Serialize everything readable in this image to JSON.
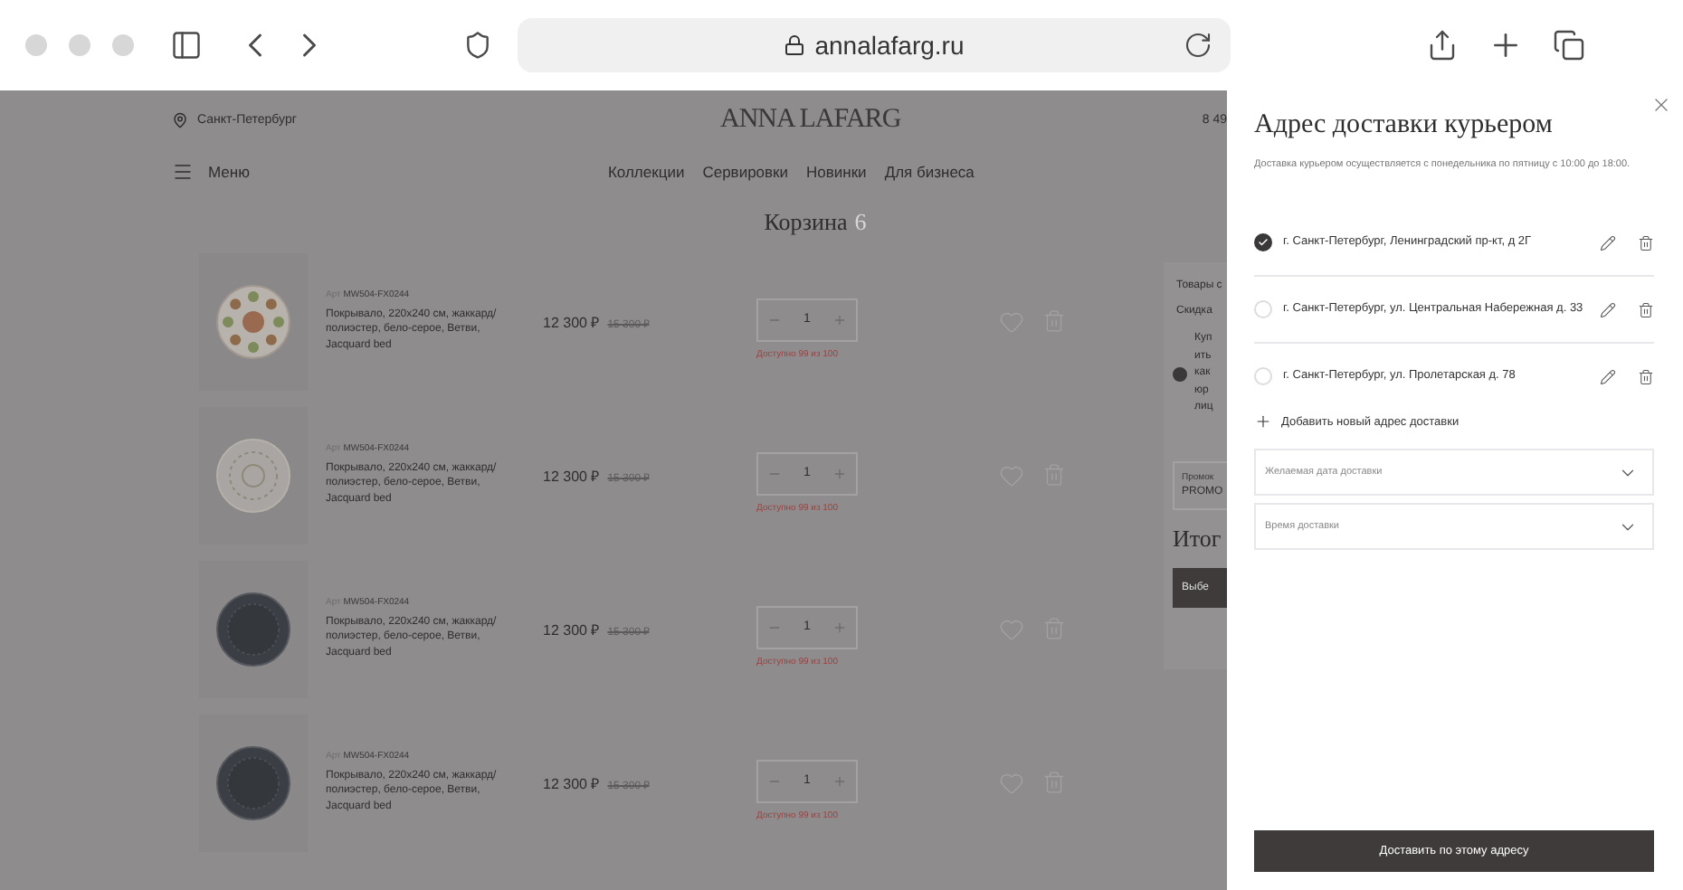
{
  "browser": {
    "url": "annalafarg.ru"
  },
  "header": {
    "city": "Санкт-Петербург",
    "logo": "ANNA LAFARG",
    "phone": "8 49"
  },
  "menu": {
    "label": "Меню"
  },
  "nav": [
    "Коллекции",
    "Сервировки",
    "Новинки",
    "Для бизнеса"
  ],
  "cart": {
    "title": "Корзина",
    "count": "6"
  },
  "items": [
    {
      "kind": "floral",
      "art_label": "Арт",
      "art": "MW504-FX0244",
      "name": "Покрывало, 220x240 см, жаккард/ полиэстер, бело-серое, Ветви, Jacquard bed",
      "price": "12 300 ₽",
      "old_price": "15 300 ₽",
      "qty": "1",
      "stock": "Доступно 99 из 100"
    },
    {
      "kind": "pale",
      "art_label": "Арт",
      "art": "MW504-FX0244",
      "name": "Покрывало, 220x240 см, жаккард/ полиэстер, бело-серое, Ветви, Jacquard bed",
      "price": "12 300 ₽",
      "old_price": "15 300 ₽",
      "qty": "1",
      "stock": "Доступно 99 из 100"
    },
    {
      "kind": "dark",
      "art_label": "Арт",
      "art": "MW504-FX0244",
      "name": "Покрывало, 220x240 см, жаккард/ полиэстер, бело-серое, Ветви, Jacquard bed",
      "price": "12 300 ₽",
      "old_price": "15 300 ₽",
      "qty": "1",
      "stock": "Доступно 99 из 100"
    },
    {
      "kind": "dark",
      "art_label": "Арт",
      "art": "MW504-FX0244",
      "name": "Покрывало, 220x240 см, жаккард/ полиэстер, бело-серое, Ветви, Jacquard bed",
      "price": "12 300 ₽",
      "old_price": "15 300 ₽",
      "qty": "1",
      "stock": "Доступно 99 из 100"
    }
  ],
  "summary": {
    "goods": "Товары с",
    "discount": "Скидка",
    "option_lines": [
      "Куп",
      "ить",
      "как",
      "юр",
      "лиц"
    ],
    "option_selected": true,
    "promo": {
      "label": "Промок",
      "value": "PROMO"
    },
    "total": "Итог",
    "button": "Выбе"
  },
  "drawer": {
    "title": "Адрес доставки курьером",
    "note": "Доставка курьером осуществляется с понедельника по пятницу с 10:00 до 18:00.",
    "addresses": [
      {
        "text": "г. Санкт-Петербург, Ленинградский пр-кт, д 2Г",
        "selected": true
      },
      {
        "text": "г. Санкт-Петербург, ул. Центральная Набережная д. 33",
        "selected": false
      },
      {
        "text": "г. Санкт-Петербург, ул. Пролетарская д. 78",
        "selected": false
      }
    ],
    "add": "Добавить новый адрес доставки",
    "selects": [
      {
        "placeholder": "Желаемая дата доставки"
      },
      {
        "placeholder": "Время доставки"
      }
    ],
    "submit": "Доставить по этому адресу"
  }
}
